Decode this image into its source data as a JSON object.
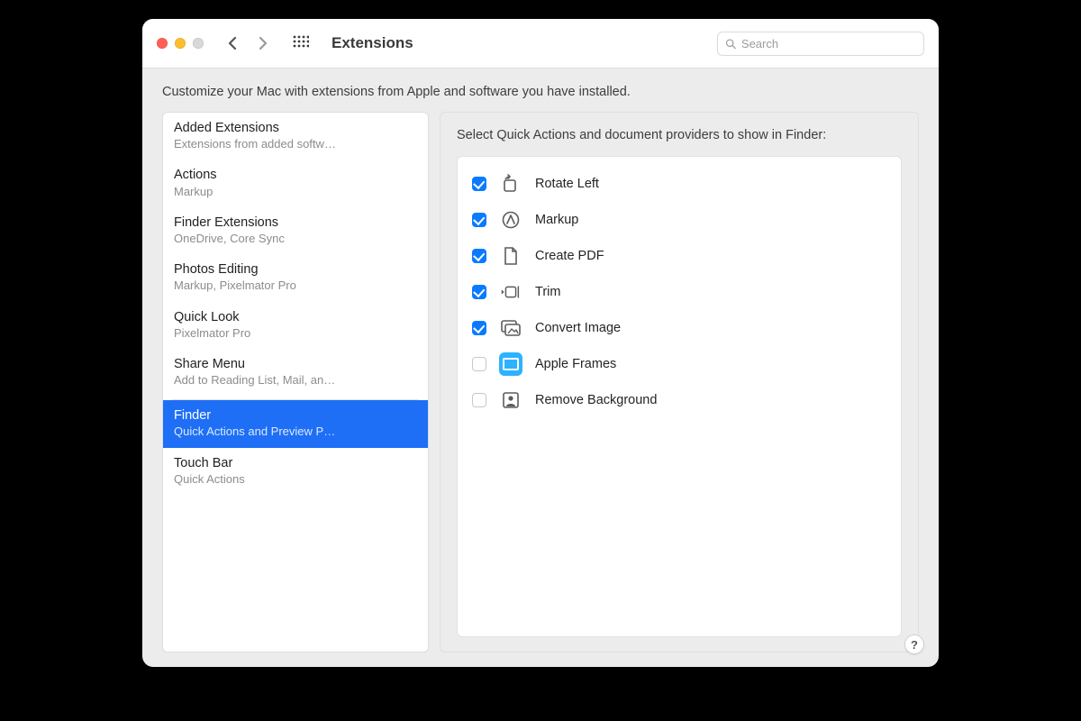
{
  "window": {
    "title": "Extensions",
    "search_placeholder": "Search",
    "help_label": "?"
  },
  "subtitle": "Customize your Mac with extensions from Apple and software you have installed.",
  "sidebar": {
    "items": [
      {
        "title": "Added Extensions",
        "subtitle": "Extensions from added softw…",
        "selected": false
      },
      {
        "title": "Actions",
        "subtitle": "Markup",
        "selected": false
      },
      {
        "title": "Finder Extensions",
        "subtitle": "OneDrive, Core Sync",
        "selected": false
      },
      {
        "title": "Photos Editing",
        "subtitle": "Markup, Pixelmator Pro",
        "selected": false
      },
      {
        "title": "Quick Look",
        "subtitle": "Pixelmator Pro",
        "selected": false
      },
      {
        "title": "Share Menu",
        "subtitle": "Add to Reading List, Mail, an…",
        "selected": false
      },
      {
        "title": "Finder",
        "subtitle": "Quick Actions and Preview P…",
        "selected": true
      },
      {
        "title": "Touch Bar",
        "subtitle": "Quick Actions",
        "selected": false
      }
    ]
  },
  "pane": {
    "heading": "Select Quick Actions and document providers to show in Finder:",
    "items": [
      {
        "label": "Rotate Left",
        "checked": true,
        "icon": "rotate-left-icon"
      },
      {
        "label": "Markup",
        "checked": true,
        "icon": "markup-icon"
      },
      {
        "label": "Create PDF",
        "checked": true,
        "icon": "document-icon"
      },
      {
        "label": "Trim",
        "checked": true,
        "icon": "trim-icon"
      },
      {
        "label": "Convert Image",
        "checked": true,
        "icon": "convert-image-icon"
      },
      {
        "label": "Apple Frames",
        "checked": false,
        "icon": "apple-frames-icon"
      },
      {
        "label": "Remove Background",
        "checked": false,
        "icon": "remove-background-icon"
      }
    ]
  }
}
